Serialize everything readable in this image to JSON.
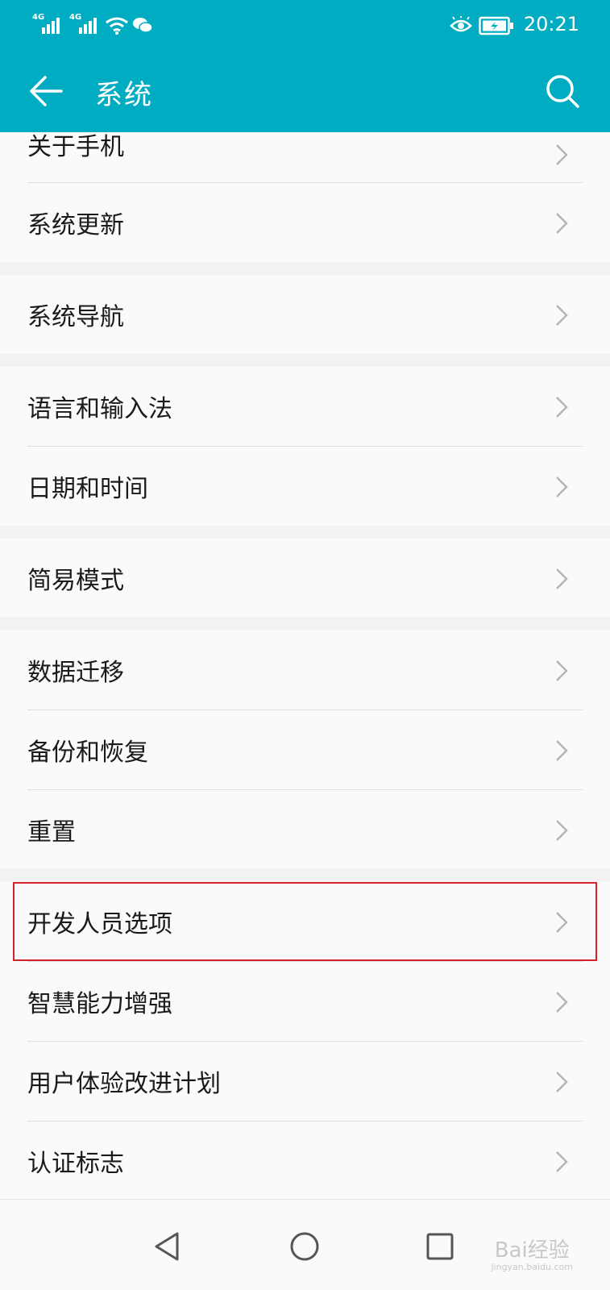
{
  "status_bar": {
    "sim1": "4G",
    "sim2": "4G",
    "time": "20:21",
    "icons": [
      "signal-icon",
      "signal-icon",
      "wifi-icon",
      "wechat-icon",
      "eye-comfort-icon",
      "battery-charging-icon"
    ]
  },
  "app_bar": {
    "title": "系统",
    "back_icon": "arrow-left-icon",
    "search_icon": "search-icon"
  },
  "groups": [
    [
      "关于手机",
      "系统更新"
    ],
    [
      "系统导航"
    ],
    [
      "语言和输入法",
      "日期和时间"
    ],
    [
      "简易模式"
    ],
    [
      "数据迁移",
      "备份和恢复",
      "重置"
    ],
    [
      "开发人员选项",
      "智慧能力增强",
      "用户体验改进计划",
      "认证标志"
    ]
  ],
  "highlighted_item": "开发人员选项",
  "nav_bar": {
    "buttons": [
      "back-triangle-icon",
      "home-circle-icon",
      "recents-square-icon"
    ]
  },
  "watermark": {
    "text": "Bai经验",
    "sub": "jingyan.baidu.com"
  },
  "colors": {
    "accent": "#00acc1",
    "highlight_border": "#d3222b",
    "list_bg": "#fafafa",
    "gap_bg": "#f2f2f2"
  }
}
